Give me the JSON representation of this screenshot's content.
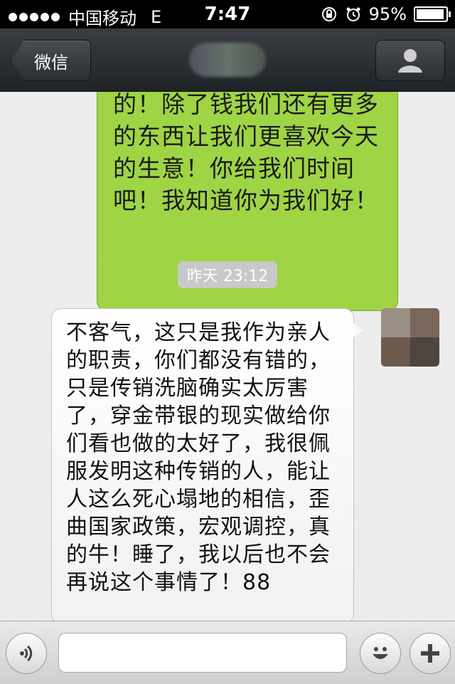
{
  "status_bar": {
    "carrier": "中国移动",
    "network": "E",
    "time": "7:47",
    "battery_percent": "95%",
    "battery_level": 0.95
  },
  "nav": {
    "back_label": "微信",
    "profile_icon": "person-icon"
  },
  "messages": [
    {
      "side": "sent",
      "color": "#9fd445",
      "text": "的！除了钱我们还有更多的东西让我们更喜欢今天的生意！你给我们时间吧！我知道你为我们好！"
    },
    {
      "side": "received",
      "color": "#ffffff",
      "text": "不客气，这只是我作为亲人的职责，你们都没有错的，只是传销洗脑确实太厉害了，穿金带银的现实做给你们看也做的太好了，我很佩服发明这种传销的人，能让人这么死心塌地的相信，歪曲国家政策，宏观调控，真的牛！睡了，我以后也不会再说这个事情了！88"
    }
  ],
  "timestamp": "昨天 23:12",
  "input_bar": {
    "voice_icon": "voice-icon",
    "emoji_icon": "smiley-icon",
    "plus_icon": "plus-icon",
    "input_value": ""
  }
}
